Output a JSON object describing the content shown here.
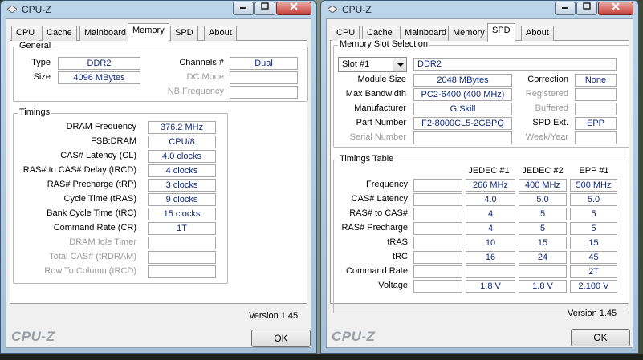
{
  "left_window": {
    "title": "CPU-Z",
    "tabs": [
      "CPU",
      "Cache",
      "Mainboard",
      "Memory",
      "SPD",
      "About"
    ],
    "active_tab": "Memory",
    "general": {
      "legend": "General",
      "type_label": "Type",
      "type_value": "DDR2",
      "size_label": "Size",
      "size_value": "4096 MBytes",
      "channels_label": "Channels #",
      "channels_value": "Dual",
      "dcmode_label": "DC Mode",
      "dcmode_value": "",
      "nbfreq_label": "NB Frequency",
      "nbfreq_value": ""
    },
    "timings": {
      "legend": "Timings",
      "rows": [
        {
          "label": "DRAM Frequency",
          "value": "376.2 MHz",
          "disabled": false
        },
        {
          "label": "FSB:DRAM",
          "value": "CPU/8",
          "disabled": false
        },
        {
          "label": "CAS# Latency (CL)",
          "value": "4.0 clocks",
          "disabled": false
        },
        {
          "label": "RAS# to CAS# Delay (tRCD)",
          "value": "4 clocks",
          "disabled": false
        },
        {
          "label": "RAS# Precharge (tRP)",
          "value": "3 clocks",
          "disabled": false
        },
        {
          "label": "Cycle Time (tRAS)",
          "value": "9 clocks",
          "disabled": false
        },
        {
          "label": "Bank Cycle Time (tRC)",
          "value": "15 clocks",
          "disabled": false
        },
        {
          "label": "Command Rate (CR)",
          "value": "1T",
          "disabled": false
        },
        {
          "label": "DRAM Idle Timer",
          "value": "",
          "disabled": true
        },
        {
          "label": "Total CAS# (tRDRAM)",
          "value": "",
          "disabled": true
        },
        {
          "label": "Row To Column (tRCD)",
          "value": "",
          "disabled": true
        }
      ]
    },
    "version": "Version 1.45",
    "brand": "CPU-Z",
    "ok_label": "OK"
  },
  "right_window": {
    "title": "CPU-Z",
    "tabs": [
      "CPU",
      "Cache",
      "Mainboard",
      "Memory",
      "SPD",
      "About"
    ],
    "active_tab": "SPD",
    "slot": {
      "legend": "Memory Slot Selection",
      "slot_value": "Slot #1",
      "type_value": "DDR2",
      "module_size_label": "Module Size",
      "module_size_value": "2048 MBytes",
      "max_bw_label": "Max Bandwidth",
      "max_bw_value": "PC2-6400 (400 MHz)",
      "manufacturer_label": "Manufacturer",
      "manufacturer_value": "G.Skill",
      "part_label": "Part Number",
      "part_value": "F2-8000CL5-2GBPQ",
      "serial_label": "Serial Number",
      "serial_value": "",
      "correction_label": "Correction",
      "correction_value": "None",
      "registered_label": "Registered",
      "registered_value": "",
      "buffered_label": "Buffered",
      "buffered_value": "",
      "spdext_label": "SPD Ext.",
      "spdext_value": "EPP",
      "weekyear_label": "Week/Year",
      "weekyear_value": ""
    },
    "timings_table": {
      "legend": "Timings Table",
      "columns": [
        "JEDEC #1",
        "JEDEC #2",
        "EPP #1"
      ],
      "rows": [
        {
          "label": "Frequency",
          "values": [
            "266 MHz",
            "400 MHz",
            "500 MHz"
          ]
        },
        {
          "label": "CAS# Latency",
          "values": [
            "4.0",
            "5.0",
            "5.0"
          ]
        },
        {
          "label": "RAS# to CAS#",
          "values": [
            "4",
            "5",
            "5"
          ]
        },
        {
          "label": "RAS# Precharge",
          "values": [
            "4",
            "5",
            "5"
          ]
        },
        {
          "label": "tRAS",
          "values": [
            "10",
            "15",
            "15"
          ]
        },
        {
          "label": "tRC",
          "values": [
            "16",
            "24",
            "45"
          ]
        },
        {
          "label": "Command Rate",
          "values": [
            "",
            "",
            "2T"
          ]
        },
        {
          "label": "Voltage",
          "values": [
            "1.8 V",
            "1.8 V",
            "2.100 V"
          ]
        }
      ]
    },
    "version": "Version 1.45",
    "brand": "CPU-Z",
    "ok_label": "OK"
  }
}
